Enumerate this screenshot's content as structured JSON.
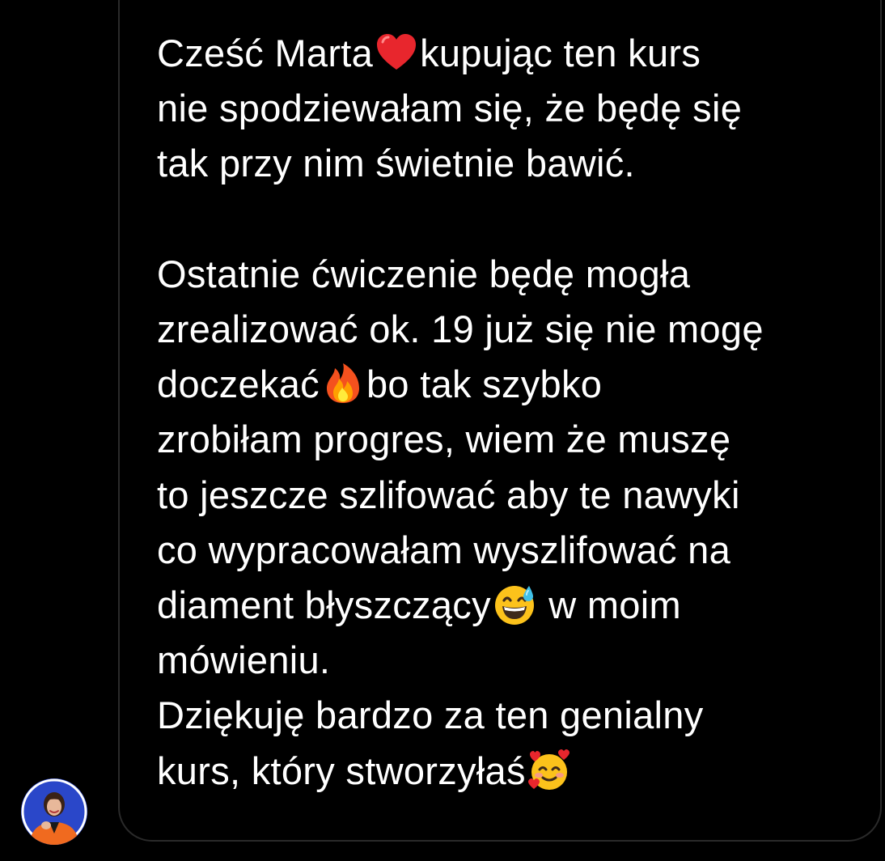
{
  "colors": {
    "background": "#000000",
    "bubble_border": "#2a2a2a",
    "text": "#ffffff",
    "avatar_bg": "#2a47c9",
    "avatar_jacket": "#f06a1f"
  },
  "message": {
    "p1": {
      "l1_a": "Cześć Marta",
      "l1_emoji": "red-heart-icon",
      "l1_b": "kupując ten kurs",
      "l2": "nie spodziewałam się, że będę się",
      "l3": "tak przy nim świetnie bawić."
    },
    "p2": {
      "l1": "Ostatnie ćwiczenie będę mogła",
      "l2": "zrealizować ok. 19 już się nie mogę",
      "l3_a": "doczekać",
      "l3_emoji": "fire-icon",
      "l3_b": "bo tak szybko",
      "l4": "zrobiłam progres, wiem że muszę",
      "l5": "to jeszcze szlifować aby te nawyki",
      "l6": "co wypracowałam wyszlifować na",
      "l7_a": "diament błyszczący",
      "l7_emoji": "grinning-sweat-icon",
      "l7_b": " w moim",
      "l8": "mówieniu."
    },
    "p3": {
      "l1": "Dziękuję bardzo za ten genialny",
      "l2_a": "kurs, który stworzyłaś",
      "l2_emoji": "smiling-face-with-hearts-icon"
    }
  },
  "sender": {
    "avatar_icon": "profile-avatar"
  }
}
